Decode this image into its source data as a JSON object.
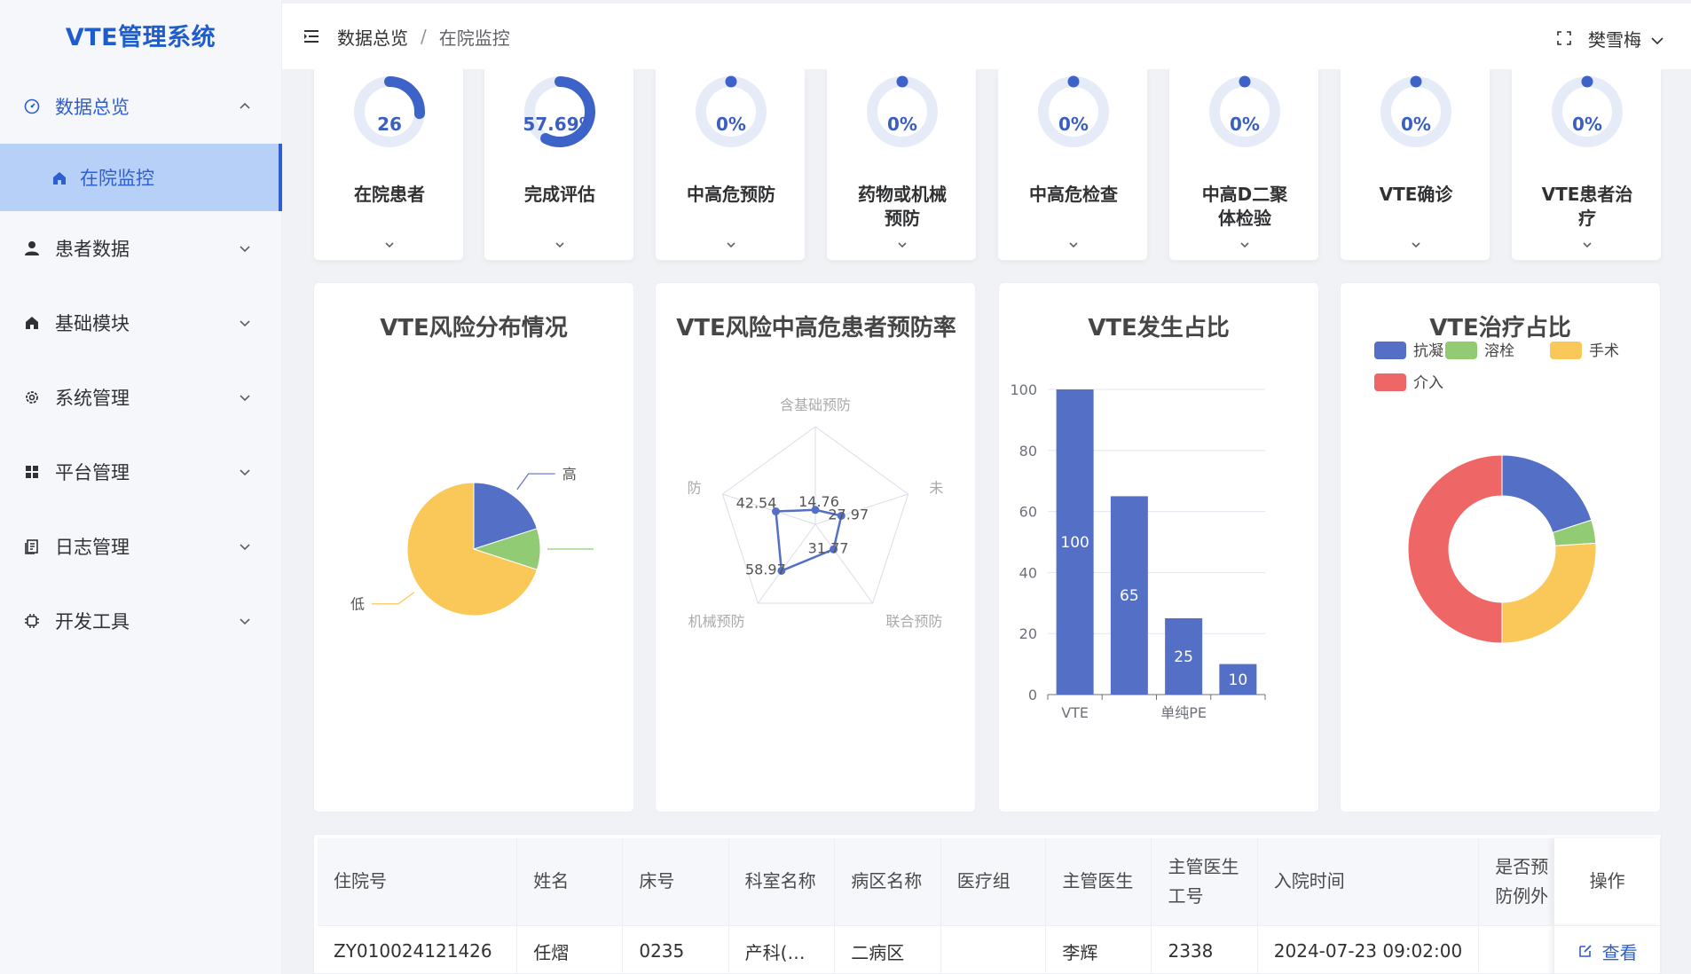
{
  "app": {
    "title": "VTE管理系统"
  },
  "sidebar": {
    "items": [
      {
        "label": "数据总览"
      },
      {
        "label": "患者数据"
      },
      {
        "label": "基础模块"
      },
      {
        "label": "系统管理"
      },
      {
        "label": "平台管理"
      },
      {
        "label": "日志管理"
      },
      {
        "label": "开发工具"
      }
    ],
    "sub_active": {
      "label": "在院监控"
    }
  },
  "header": {
    "breadcrumb": [
      "数据总览",
      "在院监控"
    ],
    "breadcrumb_sep": "/",
    "user": "樊雪梅"
  },
  "stats": [
    {
      "value": "26",
      "label": "在院患者",
      "progress": 0.26
    },
    {
      "value": "57.69%",
      "label": "完成评估",
      "progress": 0.5769
    },
    {
      "value": "0%",
      "label": "中高危预防",
      "progress": 0
    },
    {
      "value": "0%",
      "label": "药物或机械预防",
      "progress": 0
    },
    {
      "value": "0%",
      "label": "中高危检查",
      "progress": 0
    },
    {
      "value": "0%",
      "label": "中高D二聚体检验",
      "progress": 0
    },
    {
      "value": "0%",
      "label": "VTE确诊",
      "progress": 0
    },
    {
      "value": "0%",
      "label": "VTE患者治疗",
      "progress": 0
    }
  ],
  "charts": {
    "risk_title": "VTE风险分布情况",
    "prevent_title": "VTE风险中高危患者预防率",
    "occur_title": "VTE发生占比",
    "treat_title": "VTE治疗占比"
  },
  "chart_data": [
    {
      "type": "pie",
      "title": "VTE风险分布情况",
      "labels": [
        "高",
        "",
        "低"
      ],
      "values": [
        20,
        10,
        70
      ],
      "colors": [
        "#5470c6",
        "#91cc75",
        "#fac858"
      ]
    },
    {
      "type": "radar",
      "title": "VTE风险中高危患者预防率",
      "indicators": [
        "含基础预防",
        "未",
        "联合预防",
        "机械预防",
        "防"
      ],
      "values": [
        14.76,
        27.97,
        31.77,
        58.97,
        42.54
      ],
      "value_labels": [
        "14.76",
        "27.97",
        "31.77",
        "58.97",
        "42.54"
      ],
      "color": "#5470c6"
    },
    {
      "type": "bar",
      "title": "VTE发生占比",
      "categories": [
        "VTE",
        "",
        "单纯PE",
        ""
      ],
      "values": [
        100,
        65,
        25,
        10
      ],
      "yticks": [
        "0",
        "20",
        "40",
        "60",
        "80",
        "100"
      ],
      "ylim": [
        0,
        100
      ],
      "color": "#5470c6"
    },
    {
      "type": "pie",
      "title": "VTE治疗占比",
      "donut": true,
      "labels": [
        "抗凝",
        "溶栓",
        "手术",
        "介入"
      ],
      "values": [
        20,
        4,
        26,
        50
      ],
      "colors": [
        "#5470c6",
        "#91cc75",
        "#fac858",
        "#ee6666"
      ]
    }
  ],
  "table": {
    "headers": [
      "住院号",
      "姓名",
      "床号",
      "科室名称",
      "病区名称",
      "医疗组",
      "主管医生",
      "主管医生工号",
      "入院时间",
      "是否预防例外",
      "操作"
    ],
    "rows": [
      [
        "ZY010024121426",
        "任熠",
        "0235",
        "产科(…",
        "二病区",
        "",
        "李辉",
        "2338",
        "2024-07-23 09:02:00",
        "",
        "查看"
      ]
    ]
  },
  "colors": {
    "accent": "#2d5fd0",
    "active_bg": "#b7d0f7"
  }
}
